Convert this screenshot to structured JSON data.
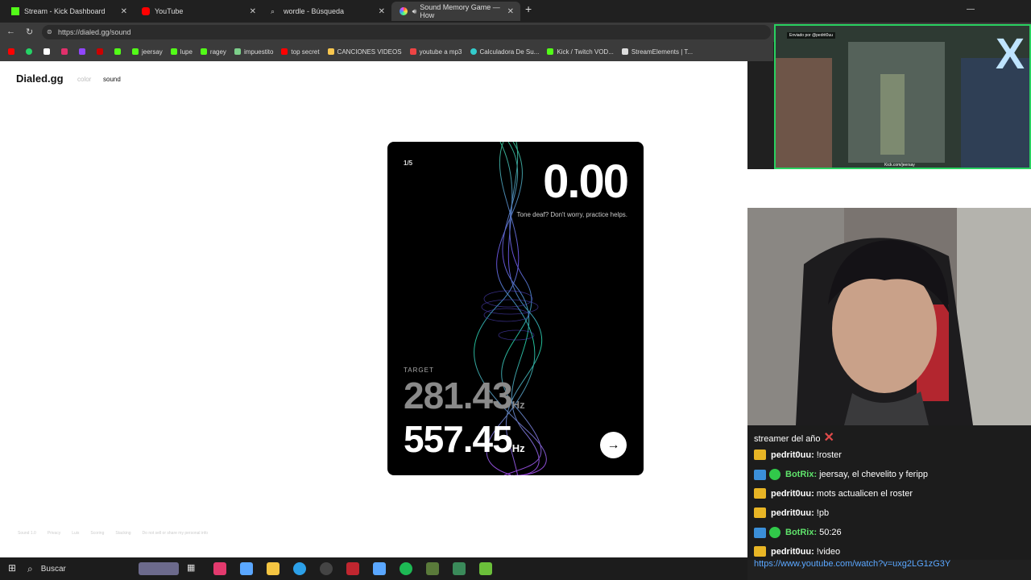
{
  "tabs": [
    {
      "label": "Stream - Kick Dashboard"
    },
    {
      "label": "YouTube"
    },
    {
      "label": "wordle - Búsqueda"
    },
    {
      "label": "Sound Memory Game — How"
    }
  ],
  "address": {
    "url": "https://dialed.gg/sound"
  },
  "bookmarks": [
    "jeersay",
    "lupe",
    "ragey",
    "impuestito",
    "top secret",
    "CANCIONES VIDEOS",
    "youtube a mp3",
    "Calculadora De Su...",
    "Kick / Twitch VOD...",
    "StreamElements | T..."
  ],
  "site": {
    "logo": "Dialed.gg",
    "nav_color": "color",
    "nav_sound": "sound",
    "footer": [
      "Sound 1.0",
      "Privacy",
      "Luis",
      "Scoring",
      "Stacking",
      "Do not sell or share my personal info"
    ]
  },
  "game": {
    "counter": "1/5",
    "score": "0.00",
    "message": "Tone deaf? Don't worry, practice helps.",
    "target_label": "TARGET",
    "target_value": "281.43",
    "guess_value": "557.45",
    "unit": "Hz",
    "next_icon": "arrow-right-icon"
  },
  "overlay": {
    "sender": "Enviado por @pedrit0uu",
    "logo": "X",
    "caption": "Kick.com/jeersay"
  },
  "chat": {
    "title": "streamer del año",
    "messages": [
      {
        "user": "pedrit0uu:",
        "text": "!roster",
        "bot": false
      },
      {
        "user": "BotRix:",
        "text": "jeersay, el chevelito y feripp",
        "bot": true
      },
      {
        "user": "pedrit0uu:",
        "text": "mots actualicen el roster",
        "bot": false
      },
      {
        "user": "pedrit0uu:",
        "text": "!pb",
        "bot": false
      },
      {
        "user": "BotRix:",
        "text": "50:26",
        "bot": true
      },
      {
        "user": "pedrit0uu:",
        "text": "!video",
        "bot": false
      }
    ],
    "link": "https://www.youtube.com/watch?v=uxg2LG1zG3Y"
  },
  "taskbar": {
    "search": "Buscar"
  },
  "colors": {
    "kick_green": "#53fc18",
    "overlay_border": "#29d160",
    "link": "#5aa7ff"
  }
}
